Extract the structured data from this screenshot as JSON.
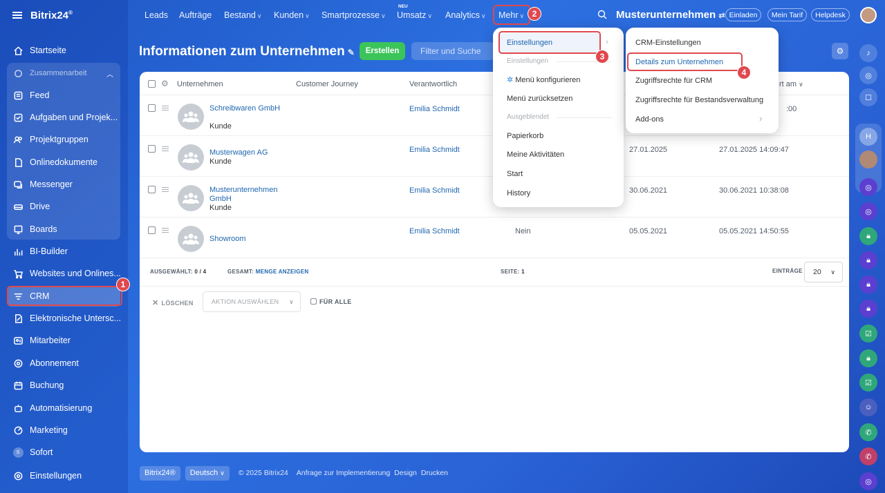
{
  "app": {
    "logo": "Bitrix24",
    "logo_sup": "®"
  },
  "topnav": {
    "items": [
      {
        "label": "Leads"
      },
      {
        "label": "Aufträge"
      },
      {
        "label": "Bestand",
        "dropdown": true
      },
      {
        "label": "Kunden",
        "dropdown": true
      },
      {
        "label": "Smartprozesse",
        "dropdown": true
      },
      {
        "label": "Umsatz",
        "dropdown": true,
        "badge": "NEU"
      },
      {
        "label": "Analytics",
        "dropdown": true
      },
      {
        "label": "Mehr",
        "dropdown": true
      }
    ],
    "company": "Musterunternehmen",
    "buttons": [
      "Einladen",
      "Mein Tarif",
      "Helpdesk"
    ]
  },
  "sidebar": {
    "items": [
      {
        "label": "Startseite",
        "icon": "home-icon"
      },
      {
        "label": "Zusammenarbeit",
        "icon": "collab-icon",
        "group_header": true
      },
      {
        "label": "Feed",
        "icon": "feed-icon"
      },
      {
        "label": "Aufgaben und Projek...",
        "icon": "tasks-icon"
      },
      {
        "label": "Projektgruppen",
        "icon": "groups-icon"
      },
      {
        "label": "Onlinedokumente",
        "icon": "docs-icon"
      },
      {
        "label": "Messenger",
        "icon": "messenger-icon"
      },
      {
        "label": "Drive",
        "icon": "drive-icon"
      },
      {
        "label": "Boards",
        "icon": "boards-icon"
      },
      {
        "label": "BI-Builder",
        "icon": "bi-icon"
      },
      {
        "label": "Websites und Onlines...",
        "icon": "websites-icon"
      },
      {
        "label": "CRM",
        "icon": "crm-icon",
        "active": true
      },
      {
        "label": "Elektronische Untersc...",
        "icon": "signature-icon"
      },
      {
        "label": "Mitarbeiter",
        "icon": "employees-icon"
      },
      {
        "label": "Abonnement",
        "icon": "subscription-icon"
      },
      {
        "label": "Buchung",
        "icon": "booking-icon"
      },
      {
        "label": "Automatisierung",
        "icon": "automation-icon"
      },
      {
        "label": "Marketing",
        "icon": "marketing-icon"
      },
      {
        "label": "Sofort",
        "icon": "sofort-icon",
        "avatar_letter": "S"
      },
      {
        "label": "Einstellungen",
        "icon": "settings-icon"
      }
    ]
  },
  "page": {
    "title": "Informationen zum Unternehmen",
    "create_label": "Erstellen",
    "filter_placeholder": "Filter und Suche"
  },
  "table": {
    "columns": [
      "Unternehmen",
      "Customer Journey",
      "Verantwortlich",
      "rt am"
    ],
    "rows": [
      {
        "name": "Schreibwaren GmbH",
        "type": "Kunde",
        "responsible": "Emilia Schmidt",
        "col_c": "",
        "date": "",
        "datetime": ":00"
      },
      {
        "name": "Musterwagen AG",
        "type": "Kunde",
        "responsible": "Emilia Schmidt",
        "col_c": "",
        "date": "27.01.2025",
        "datetime": "27.01.2025 14:09:47"
      },
      {
        "name": "Musterunternehmen GmbH",
        "type": "Kunde",
        "responsible": "Emilia Schmidt",
        "col_c": "",
        "date": "30.06.2021",
        "datetime": "30.06.2021 10:38:08"
      },
      {
        "name": "Showroom",
        "type": "",
        "responsible": "Emilia Schmidt",
        "col_c": "Nein",
        "date": "05.05.2021",
        "datetime": "05.05.2021 14:50:55"
      }
    ],
    "footer": {
      "selected_label": "AUSGEWÄHLT:",
      "selected_value": "0 / 4",
      "total_label": "GESAMT:",
      "total_link": "MENGE ANZEIGEN",
      "page_label": "SEITE:",
      "page_value": "1",
      "entries_label": "EINTRÄGE",
      "entries_value": "20"
    },
    "actions": {
      "delete": "LÖSCHEN",
      "action_select": "AKTION AUSWÄHLEN",
      "for_all": "FÜR ALLE"
    }
  },
  "menu_mehr": {
    "items": [
      {
        "label": "Einstellungen",
        "active": true
      },
      {
        "label": "Einstellungen",
        "section": true
      },
      {
        "label": "Menü konfigurieren"
      },
      {
        "label": "Menü zurücksetzen"
      },
      {
        "label": "Ausgeblendet",
        "section": true
      },
      {
        "label": "Papierkorb"
      },
      {
        "label": "Meine Aktivitäten"
      },
      {
        "label": "Start"
      },
      {
        "label": "History"
      }
    ]
  },
  "menu_settings": {
    "items": [
      {
        "label": "CRM-Einstellungen"
      },
      {
        "label": "Details zum Unternehmen",
        "active": true
      },
      {
        "label": "Zugriffsrechte für CRM"
      },
      {
        "label": "Zugriffsrechte für Bestandsverwaltung"
      },
      {
        "label": "Add-ons",
        "submenu": true
      }
    ]
  },
  "annotations": [
    "1",
    "2",
    "3",
    "4"
  ],
  "page_footer": {
    "logo": "Bitrix24®",
    "language": "Deutsch",
    "copyright": "© 2025 Bitrix24",
    "links": [
      "Anfrage zur Implementierung",
      "Design",
      "Drucken"
    ]
  },
  "colors": {
    "accent": "#2067b0",
    "create_green": "#3bc45a",
    "highlight_red": "#e0484d",
    "bg_blue": "#2a63d6"
  }
}
